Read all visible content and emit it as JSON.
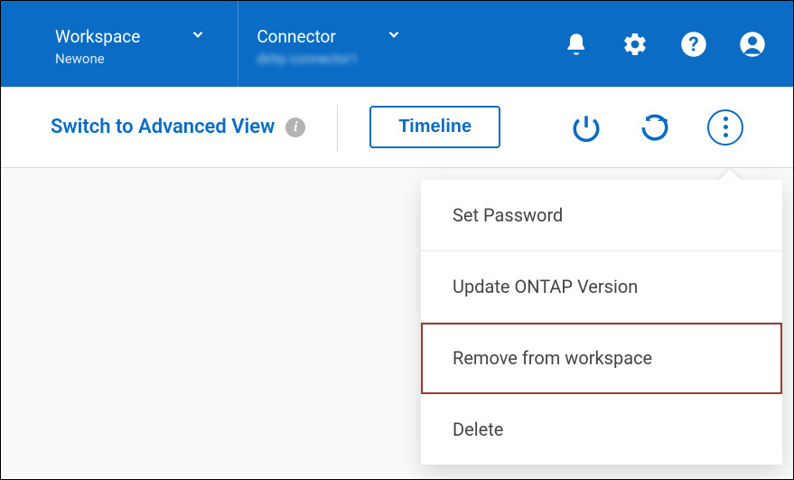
{
  "header": {
    "workspace": {
      "label": "Workspace",
      "value": "Newone"
    },
    "connector": {
      "label": "Connector",
      "value": "dirby connector1"
    }
  },
  "toolbar": {
    "switch_label": "Switch to Advanced View",
    "timeline_label": "Timeline"
  },
  "menu": {
    "items": [
      {
        "label": "Set Password",
        "selected": false
      },
      {
        "label": "Update ONTAP Version",
        "selected": false
      },
      {
        "label": "Remove from workspace",
        "selected": true
      },
      {
        "label": "Delete",
        "selected": false
      }
    ]
  }
}
